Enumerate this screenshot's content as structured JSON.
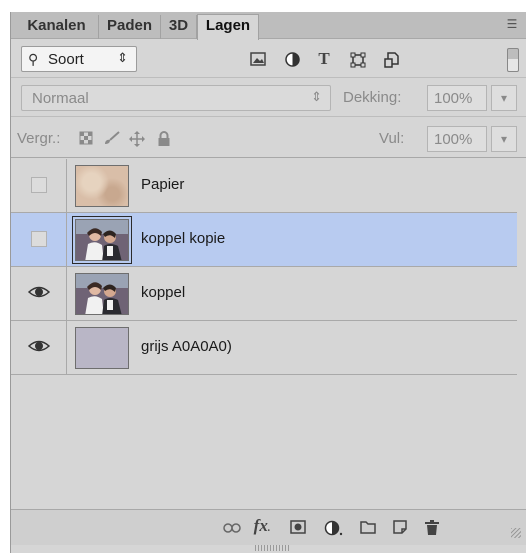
{
  "tabs": [
    {
      "label": "Kanalen",
      "active": false
    },
    {
      "label": "Paden",
      "active": false
    },
    {
      "label": "3D",
      "active": false
    },
    {
      "label": "Lagen",
      "active": true
    }
  ],
  "filter": {
    "kind_label": "Soort",
    "icons": [
      "image-filter-icon",
      "adjustment-filter-icon",
      "type-filter-icon",
      "shape-filter-icon",
      "smart-object-filter-icon"
    ]
  },
  "blend": {
    "mode": "Normaal",
    "opacity_label": "Dekking:",
    "opacity_value": "100%"
  },
  "lock": {
    "label": "Vergr.:",
    "icons": [
      "lock-transparent-icon",
      "lock-paint-icon",
      "lock-move-icon",
      "lock-all-icon"
    ],
    "fill_label": "Vul:",
    "fill_value": "100%"
  },
  "layers": [
    {
      "name": "Papier",
      "visible": false,
      "selected": false,
      "thumb": "paper"
    },
    {
      "name": "koppel kopie",
      "visible": false,
      "selected": true,
      "thumb": "photo"
    },
    {
      "name": "koppel",
      "visible": true,
      "selected": false,
      "thumb": "photo"
    },
    {
      "name": "grijs A0A0A0)",
      "visible": true,
      "selected": false,
      "thumb": "grey"
    }
  ],
  "bottom_toolbar": [
    "link-icon",
    "fx-icon",
    "mask-icon",
    "adjustment-icon",
    "folder-icon",
    "new-layer-icon",
    "trash-icon"
  ],
  "colors": {
    "panel_bg": "#d6d6d6",
    "selected_row": "#b8cbf0",
    "tab_bar": "#bdbdbd"
  }
}
